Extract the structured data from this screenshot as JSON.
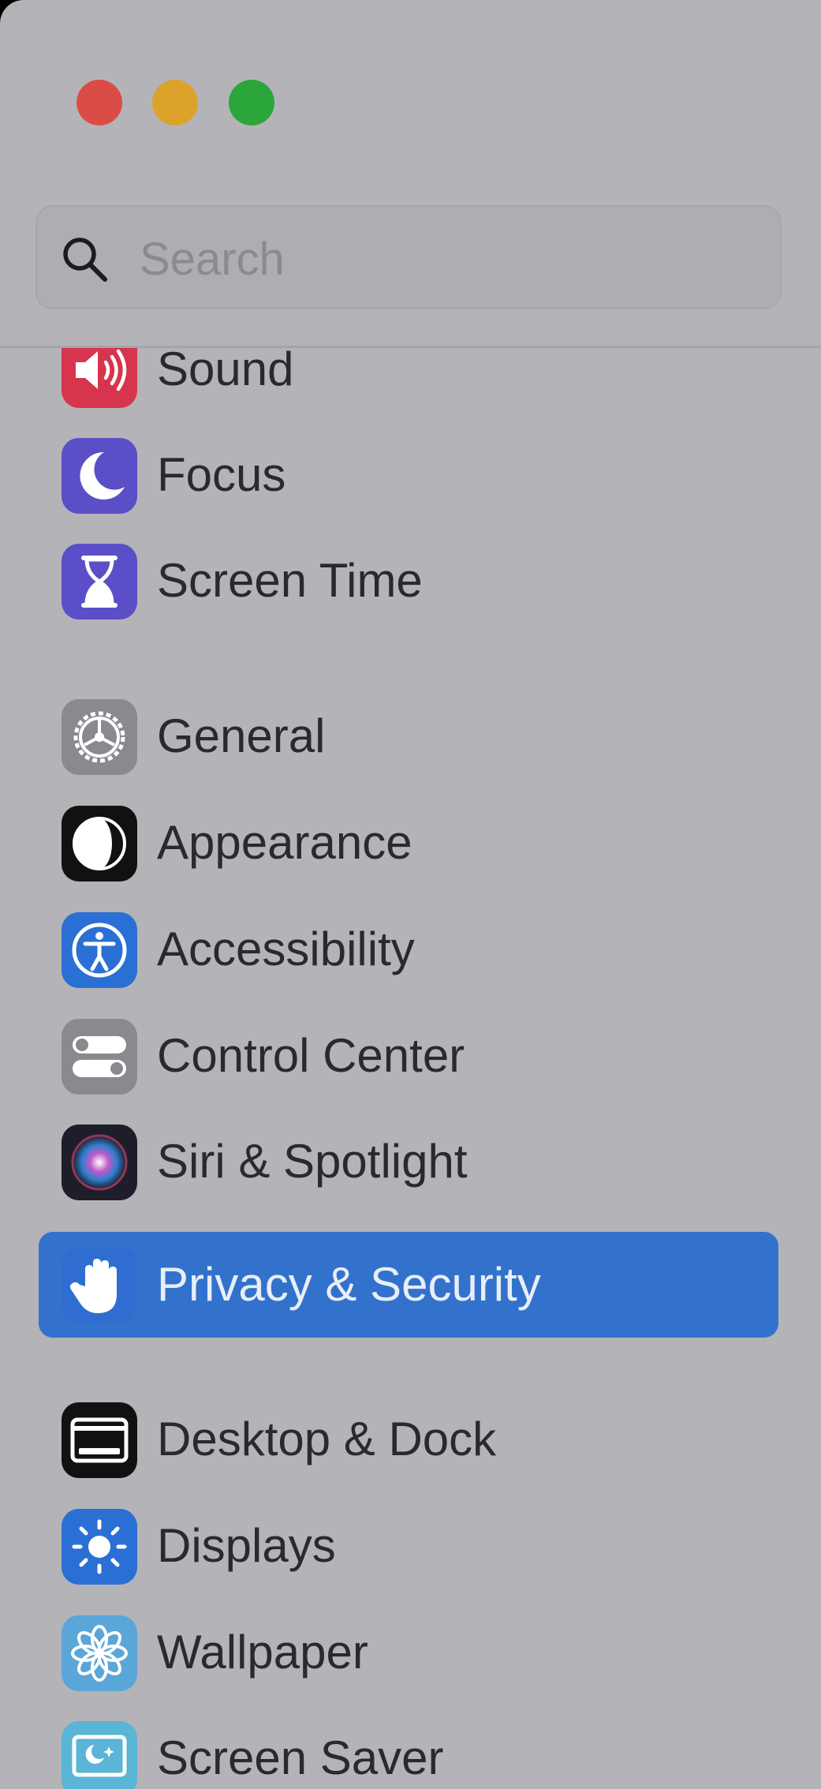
{
  "window": {
    "traffic_lights": {
      "close_color": "#da4c45",
      "minimize_color": "#dca22a",
      "zoom_color": "#2aa63a"
    }
  },
  "search": {
    "placeholder": "Search",
    "value": "",
    "icon": "magnifying-glass-icon"
  },
  "sidebar": {
    "selected_color": "#3272cc",
    "items": [
      {
        "label": "Sound",
        "icon": "speaker-icon",
        "color": "#d7354d"
      },
      {
        "label": "Focus",
        "icon": "moon-icon",
        "color": "#5a4fc7"
      },
      {
        "label": "Screen Time",
        "icon": "hourglass-icon",
        "color": "#5a4fc7"
      },
      {
        "label": "General",
        "icon": "gear-icon",
        "color": "#8a898e"
      },
      {
        "label": "Appearance",
        "icon": "appearance-icon",
        "color": "#111111"
      },
      {
        "label": "Accessibility",
        "icon": "accessibility-icon",
        "color": "#2a6fd4"
      },
      {
        "label": "Control Center",
        "icon": "toggles-icon",
        "color": "#8a898e"
      },
      {
        "label": "Siri & Spotlight",
        "icon": "siri-icon",
        "color": "#1e1e2a"
      },
      {
        "label": "Privacy & Security",
        "icon": "hand-icon",
        "color": "#2f6ed0",
        "selected": true
      },
      {
        "label": "Desktop & Dock",
        "icon": "dock-icon",
        "color": "#111111"
      },
      {
        "label": "Displays",
        "icon": "sun-icon",
        "color": "#2a6fd4"
      },
      {
        "label": "Wallpaper",
        "icon": "flower-icon",
        "color": "#5aa6d8"
      },
      {
        "label": "Screen Saver",
        "icon": "screensaver-icon",
        "color": "#5ab5d6"
      }
    ]
  }
}
